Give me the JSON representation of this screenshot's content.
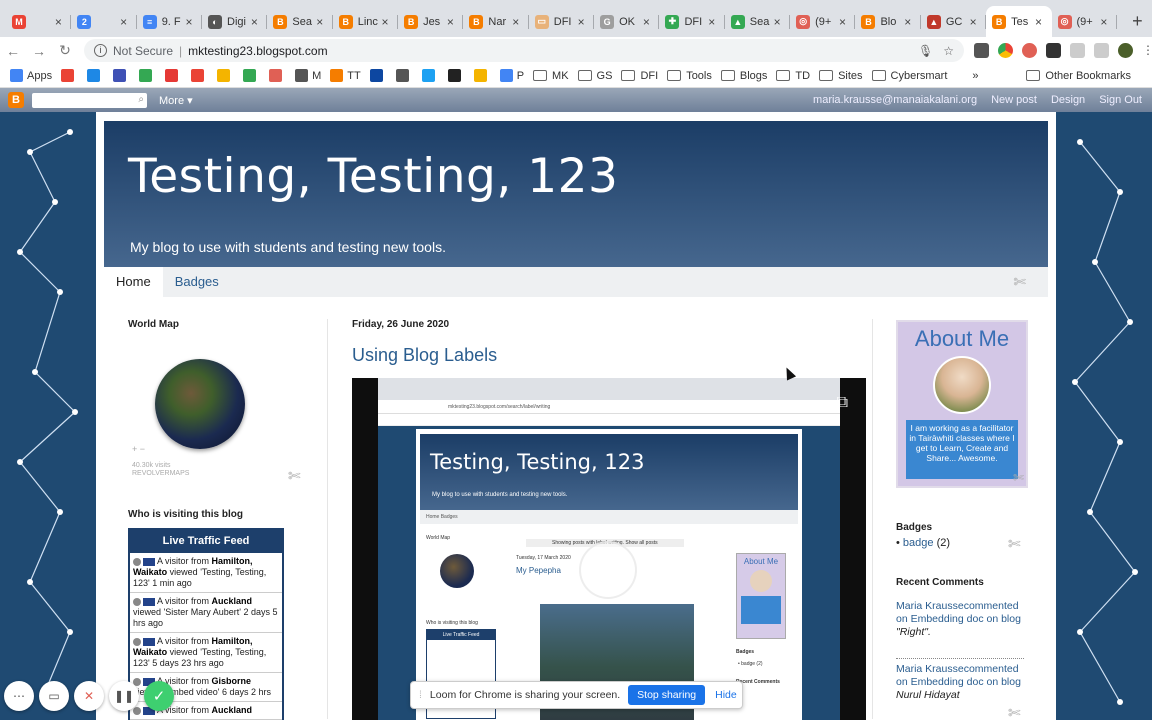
{
  "browser": {
    "tabs": [
      {
        "label": "",
        "color": "#ea4335",
        "glyph": "M"
      },
      {
        "label": "",
        "color": "#4285f4",
        "glyph": "2"
      },
      {
        "label": "9. F",
        "color": "#4285f4",
        "glyph": "≡"
      },
      {
        "label": "Digi",
        "color": "#555555",
        "glyph": "◐"
      },
      {
        "label": "Sea",
        "color": "#f57d00",
        "glyph": "B"
      },
      {
        "label": "Linc",
        "color": "#f57d00",
        "glyph": "B"
      },
      {
        "label": "Jes",
        "color": "#f57d00",
        "glyph": "B"
      },
      {
        "label": "Nar",
        "color": "#f57d00",
        "glyph": "B"
      },
      {
        "label": "DFI",
        "color": "#e8b27a",
        "glyph": "▭"
      },
      {
        "label": "OK",
        "color": "#9e9e9e",
        "glyph": "G"
      },
      {
        "label": "DFI",
        "color": "#34a853",
        "glyph": "✚"
      },
      {
        "label": "Sea",
        "color": "#34a853",
        "glyph": "▲"
      },
      {
        "label": "(9+",
        "color": "#e06055",
        "glyph": "◎"
      },
      {
        "label": "Blo",
        "color": "#f57d00",
        "glyph": "B"
      },
      {
        "label": "GC",
        "color": "#c0392b",
        "glyph": "▲"
      },
      {
        "label": "Tes",
        "color": "#f57d00",
        "glyph": "B",
        "active": true
      },
      {
        "label": "(9+",
        "color": "#e06055",
        "glyph": "◎"
      }
    ],
    "address": {
      "security": "Not Secure",
      "url": "mktesting23.blogspot.com"
    },
    "bookmarks": [
      {
        "label": "Apps",
        "color": "#4285f4"
      },
      {
        "label": "",
        "color": "#ea4335"
      },
      {
        "label": "",
        "color": "#1e88e5"
      },
      {
        "label": "",
        "color": "#3f51b5"
      },
      {
        "label": "",
        "color": "#34a853"
      },
      {
        "label": "",
        "color": "#e53935"
      },
      {
        "label": "",
        "color": "#ea4335"
      },
      {
        "label": "",
        "color": "#f4b400"
      },
      {
        "label": "",
        "color": "#34a853"
      },
      {
        "label": "",
        "color": "#e06055"
      },
      {
        "label": "M",
        "color": "#555555"
      },
      {
        "label": "TT",
        "color": "#f57d00"
      },
      {
        "label": "",
        "color": "#0d47a1"
      },
      {
        "label": "",
        "color": "#555555"
      },
      {
        "label": "",
        "color": "#1da1f2"
      },
      {
        "label": "",
        "color": "#222222"
      },
      {
        "label": "",
        "color": "#f4b400"
      },
      {
        "label": "P",
        "color": "#4285f4"
      }
    ],
    "folders": [
      "MK",
      "GS",
      "DFI",
      "Tools",
      "Blogs",
      "TD",
      "Sites",
      "Cybersmart"
    ],
    "other_bookmarks": "Other Bookmarks",
    "more_chevron": "»"
  },
  "blogger_bar": {
    "more": "More ▾",
    "email": "maria.krausse@manaiakalani.org",
    "new_post": "New post",
    "design": "Design",
    "sign_out": "Sign Out"
  },
  "blog": {
    "title": "Testing, Testing, 123",
    "description": "My blog to use with students and testing new tools.",
    "tabs": [
      "Home",
      "Badges"
    ]
  },
  "sidebar_left": {
    "world_map_title": "World Map",
    "globe_controls": "+  −",
    "visits": "40.30k visits",
    "revolvermaps": "REVOLVERMAPS",
    "visiting_title": "Who is visiting this blog",
    "feed_title": "Live Traffic Feed",
    "feed": [
      {
        "prefix": "A visitor from ",
        "city": "Hamilton, Waikato",
        "rest": " viewed 'Testing, Testing, 123' 1 min ago"
      },
      {
        "prefix": "A visitor from ",
        "city": "Auckland",
        "rest": " viewed 'Sister Mary Aubert' 2 days 5 hrs ago"
      },
      {
        "prefix": "A visitor from ",
        "city": "Hamilton, Waikato",
        "rest": " viewed 'Testing, Testing, 123' 5 days 23 hrs ago"
      },
      {
        "prefix": "A visitor from ",
        "city": "Gisborne",
        "rest": " viewed 'Embed video' 6 days 2 hrs"
      },
      {
        "prefix": "A visitor from ",
        "city": "Auckland",
        "rest": ""
      }
    ]
  },
  "post": {
    "date": "Friday, 26 June 2020",
    "title": "Using Blog Labels",
    "video": {
      "inner_title": "Testing, Testing, 123",
      "inner_desc": "My blog to use with students and testing new tools.",
      "inner_url": "mktesting23.blogspot.com/search/label/writing",
      "inner_nav": "Home     Badges",
      "inner_world_map": "World Map",
      "inner_showing": "Showing posts with label writing. Show all posts",
      "inner_date": "Tuesday, 17 March 2020",
      "inner_post": "My Pepepha",
      "inner_visiting": "Who is visiting this blog",
      "inner_feed": "Live Traffic Feed",
      "inner_about": "About Me",
      "inner_badges": "Badges",
      "inner_badge": "• badge (2)",
      "inner_recent": "Recent Comments"
    }
  },
  "sidebar_right": {
    "about_title": "About Me",
    "about_text": "I am working as a facilitator in Tairāwhiti classes where I get to Learn, Create and Share... Awesome.",
    "badges_title": "Badges",
    "badge_link": "badge",
    "badge_count": "(2)",
    "recent_title": "Recent Comments",
    "comments": [
      {
        "text": "Maria Kraussecommented on Embedding doc on blog",
        "quote": "\"Right\"."
      },
      {
        "text": "Maria Kraussecommented on Embedding doc on blog",
        "quote": "Nurul Hidayat"
      }
    ]
  },
  "share_bar": {
    "message": "Loom for Chrome is sharing your screen.",
    "stop": "Stop sharing",
    "hide": "Hide"
  }
}
